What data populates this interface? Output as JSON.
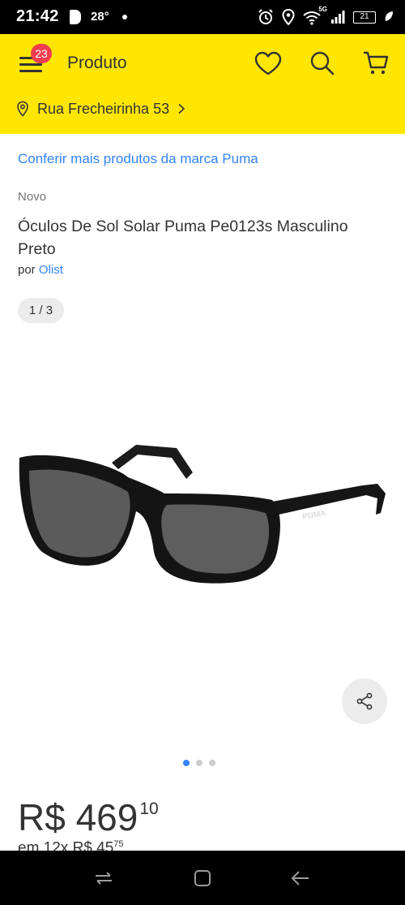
{
  "status_bar": {
    "time": "21:42",
    "temperature": "28°",
    "network": "5G",
    "battery": "21"
  },
  "header": {
    "title": "Produto",
    "cart_badge_count": "23",
    "background_color": "#ffe600",
    "address": "Rua Frecheirinha 53",
    "icons": [
      "menu-icon",
      "heart-icon",
      "search-icon",
      "cart-icon",
      "location-pin-icon",
      "chevron-right-icon"
    ]
  },
  "product": {
    "brand_link": "Conferir mais produtos da marca Puma",
    "condition": "Novo",
    "title": "Óculos De Sol Solar Puma Pe0123s Masculino Preto",
    "seller_prefix": "por",
    "seller_name": "Olist",
    "image_counter": "1 / 3",
    "brand_on_image": "PUMA",
    "image_pages": 3,
    "image_current": 1
  },
  "price": {
    "currency": "R$",
    "main": "R$ 469",
    "cents": "10",
    "installments_prefix": "em 12x R$ 45",
    "installments_cents": "75"
  },
  "colors": {
    "link": "#3483fa",
    "badge": "#f23d4f",
    "active_dot": "#3483fa"
  }
}
